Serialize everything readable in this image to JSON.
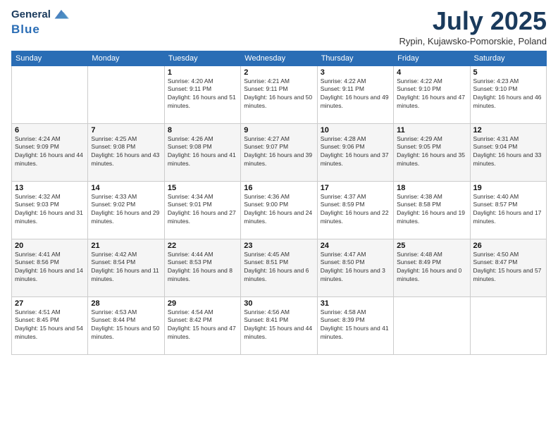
{
  "header": {
    "logo_line1": "General",
    "logo_line2": "Blue",
    "month_title": "July 2025",
    "location": "Rypin, Kujawsko-Pomorskie, Poland"
  },
  "days": [
    "Sunday",
    "Monday",
    "Tuesday",
    "Wednesday",
    "Thursday",
    "Friday",
    "Saturday"
  ],
  "weeks": [
    [
      {
        "date": "",
        "sunrise": "",
        "sunset": "",
        "daylight": ""
      },
      {
        "date": "",
        "sunrise": "",
        "sunset": "",
        "daylight": ""
      },
      {
        "date": "1",
        "sunrise": "Sunrise: 4:20 AM",
        "sunset": "Sunset: 9:11 PM",
        "daylight": "Daylight: 16 hours and 51 minutes."
      },
      {
        "date": "2",
        "sunrise": "Sunrise: 4:21 AM",
        "sunset": "Sunset: 9:11 PM",
        "daylight": "Daylight: 16 hours and 50 minutes."
      },
      {
        "date": "3",
        "sunrise": "Sunrise: 4:22 AM",
        "sunset": "Sunset: 9:11 PM",
        "daylight": "Daylight: 16 hours and 49 minutes."
      },
      {
        "date": "4",
        "sunrise": "Sunrise: 4:22 AM",
        "sunset": "Sunset: 9:10 PM",
        "daylight": "Daylight: 16 hours and 47 minutes."
      },
      {
        "date": "5",
        "sunrise": "Sunrise: 4:23 AM",
        "sunset": "Sunset: 9:10 PM",
        "daylight": "Daylight: 16 hours and 46 minutes."
      }
    ],
    [
      {
        "date": "6",
        "sunrise": "Sunrise: 4:24 AM",
        "sunset": "Sunset: 9:09 PM",
        "daylight": "Daylight: 16 hours and 44 minutes."
      },
      {
        "date": "7",
        "sunrise": "Sunrise: 4:25 AM",
        "sunset": "Sunset: 9:08 PM",
        "daylight": "Daylight: 16 hours and 43 minutes."
      },
      {
        "date": "8",
        "sunrise": "Sunrise: 4:26 AM",
        "sunset": "Sunset: 9:08 PM",
        "daylight": "Daylight: 16 hours and 41 minutes."
      },
      {
        "date": "9",
        "sunrise": "Sunrise: 4:27 AM",
        "sunset": "Sunset: 9:07 PM",
        "daylight": "Daylight: 16 hours and 39 minutes."
      },
      {
        "date": "10",
        "sunrise": "Sunrise: 4:28 AM",
        "sunset": "Sunset: 9:06 PM",
        "daylight": "Daylight: 16 hours and 37 minutes."
      },
      {
        "date": "11",
        "sunrise": "Sunrise: 4:29 AM",
        "sunset": "Sunset: 9:05 PM",
        "daylight": "Daylight: 16 hours and 35 minutes."
      },
      {
        "date": "12",
        "sunrise": "Sunrise: 4:31 AM",
        "sunset": "Sunset: 9:04 PM",
        "daylight": "Daylight: 16 hours and 33 minutes."
      }
    ],
    [
      {
        "date": "13",
        "sunrise": "Sunrise: 4:32 AM",
        "sunset": "Sunset: 9:03 PM",
        "daylight": "Daylight: 16 hours and 31 minutes."
      },
      {
        "date": "14",
        "sunrise": "Sunrise: 4:33 AM",
        "sunset": "Sunset: 9:02 PM",
        "daylight": "Daylight: 16 hours and 29 minutes."
      },
      {
        "date": "15",
        "sunrise": "Sunrise: 4:34 AM",
        "sunset": "Sunset: 9:01 PM",
        "daylight": "Daylight: 16 hours and 27 minutes."
      },
      {
        "date": "16",
        "sunrise": "Sunrise: 4:36 AM",
        "sunset": "Sunset: 9:00 PM",
        "daylight": "Daylight: 16 hours and 24 minutes."
      },
      {
        "date": "17",
        "sunrise": "Sunrise: 4:37 AM",
        "sunset": "Sunset: 8:59 PM",
        "daylight": "Daylight: 16 hours and 22 minutes."
      },
      {
        "date": "18",
        "sunrise": "Sunrise: 4:38 AM",
        "sunset": "Sunset: 8:58 PM",
        "daylight": "Daylight: 16 hours and 19 minutes."
      },
      {
        "date": "19",
        "sunrise": "Sunrise: 4:40 AM",
        "sunset": "Sunset: 8:57 PM",
        "daylight": "Daylight: 16 hours and 17 minutes."
      }
    ],
    [
      {
        "date": "20",
        "sunrise": "Sunrise: 4:41 AM",
        "sunset": "Sunset: 8:56 PM",
        "daylight": "Daylight: 16 hours and 14 minutes."
      },
      {
        "date": "21",
        "sunrise": "Sunrise: 4:42 AM",
        "sunset": "Sunset: 8:54 PM",
        "daylight": "Daylight: 16 hours and 11 minutes."
      },
      {
        "date": "22",
        "sunrise": "Sunrise: 4:44 AM",
        "sunset": "Sunset: 8:53 PM",
        "daylight": "Daylight: 16 hours and 8 minutes."
      },
      {
        "date": "23",
        "sunrise": "Sunrise: 4:45 AM",
        "sunset": "Sunset: 8:51 PM",
        "daylight": "Daylight: 16 hours and 6 minutes."
      },
      {
        "date": "24",
        "sunrise": "Sunrise: 4:47 AM",
        "sunset": "Sunset: 8:50 PM",
        "daylight": "Daylight: 16 hours and 3 minutes."
      },
      {
        "date": "25",
        "sunrise": "Sunrise: 4:48 AM",
        "sunset": "Sunset: 8:49 PM",
        "daylight": "Daylight: 16 hours and 0 minutes."
      },
      {
        "date": "26",
        "sunrise": "Sunrise: 4:50 AM",
        "sunset": "Sunset: 8:47 PM",
        "daylight": "Daylight: 15 hours and 57 minutes."
      }
    ],
    [
      {
        "date": "27",
        "sunrise": "Sunrise: 4:51 AM",
        "sunset": "Sunset: 8:45 PM",
        "daylight": "Daylight: 15 hours and 54 minutes."
      },
      {
        "date": "28",
        "sunrise": "Sunrise: 4:53 AM",
        "sunset": "Sunset: 8:44 PM",
        "daylight": "Daylight: 15 hours and 50 minutes."
      },
      {
        "date": "29",
        "sunrise": "Sunrise: 4:54 AM",
        "sunset": "Sunset: 8:42 PM",
        "daylight": "Daylight: 15 hours and 47 minutes."
      },
      {
        "date": "30",
        "sunrise": "Sunrise: 4:56 AM",
        "sunset": "Sunset: 8:41 PM",
        "daylight": "Daylight: 15 hours and 44 minutes."
      },
      {
        "date": "31",
        "sunrise": "Sunrise: 4:58 AM",
        "sunset": "Sunset: 8:39 PM",
        "daylight": "Daylight: 15 hours and 41 minutes."
      },
      {
        "date": "",
        "sunrise": "",
        "sunset": "",
        "daylight": ""
      },
      {
        "date": "",
        "sunrise": "",
        "sunset": "",
        "daylight": ""
      }
    ]
  ]
}
